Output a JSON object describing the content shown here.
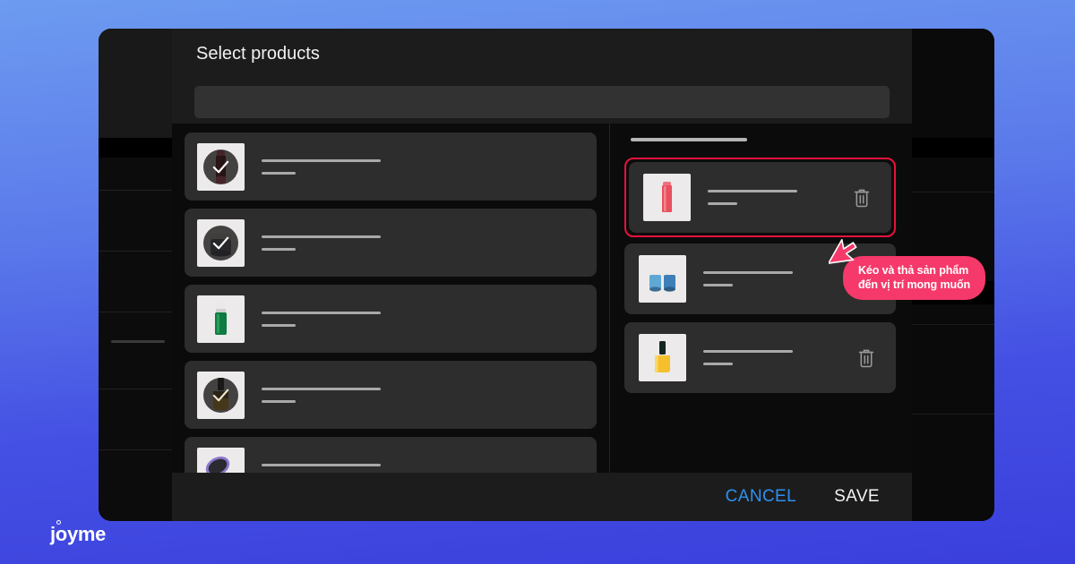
{
  "brand": {
    "name": "joyme"
  },
  "modal": {
    "title": "Select products",
    "search": {
      "value": "",
      "placeholder": ""
    },
    "footer": {
      "cancel_label": "CANCEL",
      "save_label": "SAVE"
    }
  },
  "left_panel": {
    "name": "available-products-list",
    "items": [
      {
        "icon": "lipstick-red-icon",
        "selected": true,
        "line1": "",
        "line2": ""
      },
      {
        "icon": "cream-jar-icon",
        "selected": true,
        "line1": "",
        "line2": ""
      },
      {
        "icon": "serum-dropper-icon",
        "selected": false,
        "line1": "",
        "line2": ""
      },
      {
        "icon": "nail-polish-gold-icon",
        "selected": true,
        "line1": "",
        "line2": ""
      },
      {
        "icon": "hairbrush-icon",
        "selected": false,
        "line1": "",
        "line2": ""
      }
    ]
  },
  "right_panel": {
    "name": "selected-products-list",
    "header_skeleton": true,
    "items": [
      {
        "icon": "lipstick-red-icon",
        "dragging": true,
        "delete_label": "trash-icon",
        "line1": "",
        "line2": ""
      },
      {
        "icon": "cream-jar-blue-icon",
        "dragging": false,
        "delete_label": "trash-icon",
        "line1": "",
        "line2": ""
      },
      {
        "icon": "nail-polish-yellow-icon",
        "dragging": false,
        "delete_label": "trash-icon",
        "line1": "",
        "line2": ""
      }
    ]
  },
  "tooltip": {
    "line1": "Kéo và thả sản phẩm",
    "line2": "đến vị trí mong muốn"
  },
  "colors": {
    "background_top": "#6d9bf0",
    "background_bottom": "#3a3fdc",
    "modal_surface": "#1c1c1c",
    "list_background": "#0b0b0b",
    "card_surface": "#2d2d2d",
    "drag_highlight": "#e8123c",
    "tooltip_background": "#f5396a",
    "cancel_text": "#2e90f0",
    "save_text": "#f3f3f3"
  }
}
